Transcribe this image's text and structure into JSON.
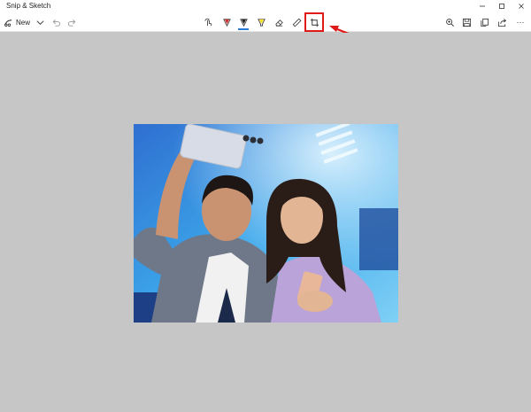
{
  "window": {
    "title": "Snip & Sketch"
  },
  "toolbar": {
    "new_label": "New",
    "left_icons": [
      "snip-icon",
      "chevron-down-icon",
      "undo-icon",
      "redo-icon"
    ],
    "tools": [
      "touch-writing-icon",
      "ballpoint-pen-icon",
      "pencil-icon",
      "highlighter-icon",
      "eraser-icon",
      "ruler-icon",
      "crop-icon"
    ],
    "selected_tool": "pencil-icon",
    "right_icons": [
      "zoom-icon",
      "save-icon",
      "copy-icon",
      "share-icon",
      "more-icon"
    ],
    "more_label": "···"
  },
  "annotation": {
    "highlighted_tool": "crop-icon",
    "color": "#e01919"
  },
  "colors": {
    "canvas_bg": "#c6c6c6",
    "accent": "#2b79d6",
    "pen_red": "#d42b2b",
    "highlighter_yellow": "#f5e21b"
  }
}
